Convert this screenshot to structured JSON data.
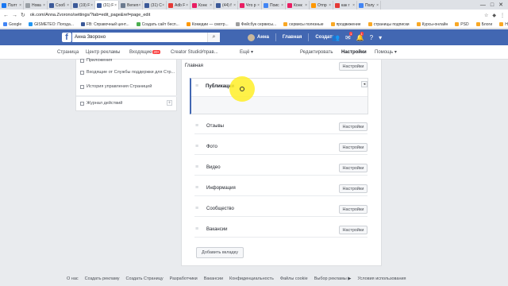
{
  "browser": {
    "tabs": [
      {
        "label": "Полт",
        "color": "#1877f2"
      },
      {
        "label": "Нова",
        "color": "#9aa0a6"
      },
      {
        "label": "Сооб",
        "color": "#3b5998"
      },
      {
        "label": "(19) F",
        "color": "#3b5998"
      },
      {
        "label": "(31) F",
        "color": "#3b5998",
        "active": true
      },
      {
        "label": "Benen",
        "color": "#6b7a8f"
      },
      {
        "label": "(31) C",
        "color": "#3b5998"
      },
      {
        "label": "Adb F",
        "color": "#e53935"
      },
      {
        "label": "Конк",
        "color": "#e91e63"
      },
      {
        "label": "(44) f",
        "color": "#3b5998"
      },
      {
        "label": "Что р",
        "color": "#e91e63"
      },
      {
        "label": "Поис",
        "color": "#4285f4"
      },
      {
        "label": "Конк",
        "color": "#e91e63"
      },
      {
        "label": "Отпр",
        "color": "#ff9800"
      },
      {
        "label": "как г",
        "color": "#e53935"
      },
      {
        "label": "Полу",
        "color": "#4285f4"
      }
    ],
    "window_controls": [
      "—",
      "□",
      "✕"
    ],
    "url": "ok.com/Anna.Zvorono/settings/?tab=edit_page&ref=page_edit",
    "bookmarks": [
      {
        "label": "Google",
        "color": "#4285f4"
      },
      {
        "label": "GISMETEO: Погода...",
        "color": "#2196f3"
      },
      {
        "label": "FB: Справочный цент...",
        "color": "#3b5998"
      },
      {
        "label": "Создать сайт бесп...",
        "color": "#4caf50"
      },
      {
        "label": "Комедии — смотр...",
        "color": "#ff9800"
      },
      {
        "label": "Фейсбук сервисы...",
        "color": "#9e9e9e"
      },
      {
        "label": "сервисы полезные",
        "color": "#f9a825"
      },
      {
        "label": "продвижение",
        "color": "#f9a825"
      },
      {
        "label": "страницы подписки",
        "color": "#f9a825"
      },
      {
        "label": "Курсы-онлайн",
        "color": "#f9a825"
      },
      {
        "label": "PSD",
        "color": "#f9a825"
      },
      {
        "label": "Блоги",
        "color": "#f9a825"
      },
      {
        "label": "Нужные вебинары",
        "color": "#f9a825"
      }
    ]
  },
  "fb": {
    "logo": "f",
    "search_value": "Анна Зворонo",
    "user_name": "Анна",
    "nav_home": "Главная",
    "nav_create": "Создать",
    "notif_badge_1": "1",
    "notif_badge_2": "1"
  },
  "page_nav": {
    "page": "Страница",
    "ads_center": "Центр рекламы",
    "inbox": "Входящие",
    "inbox_badge": "20+",
    "creator_studio": "Creator Studio",
    "manage": "Управ...",
    "more": "Ещё ▾",
    "edit": "Редактировать",
    "settings": "Настройки",
    "help": "Помощь ▾"
  },
  "left_menu": {
    "item0": "Приложения",
    "item1": "Входящие от Службы поддержки для Стр...",
    "item2": "История управления Страницей",
    "item3": "Журнал действий"
  },
  "main": {
    "top_row_label": "Главная",
    "expanded_label": "Публикации",
    "settings_label": "Настройки",
    "rows": [
      "Отзывы",
      "Фото",
      "Видео",
      "Информация",
      "Сообщество",
      "Вакансии"
    ],
    "add_tab": "Добавить вкладку"
  },
  "footer": [
    "О нас",
    "Создать рекламу",
    "Создать Страницу",
    "Разработчики",
    "Вакансии",
    "Конфиденциальность",
    "Файлы cookie",
    "Выбор рекламы ▶",
    "Условия использования"
  ]
}
